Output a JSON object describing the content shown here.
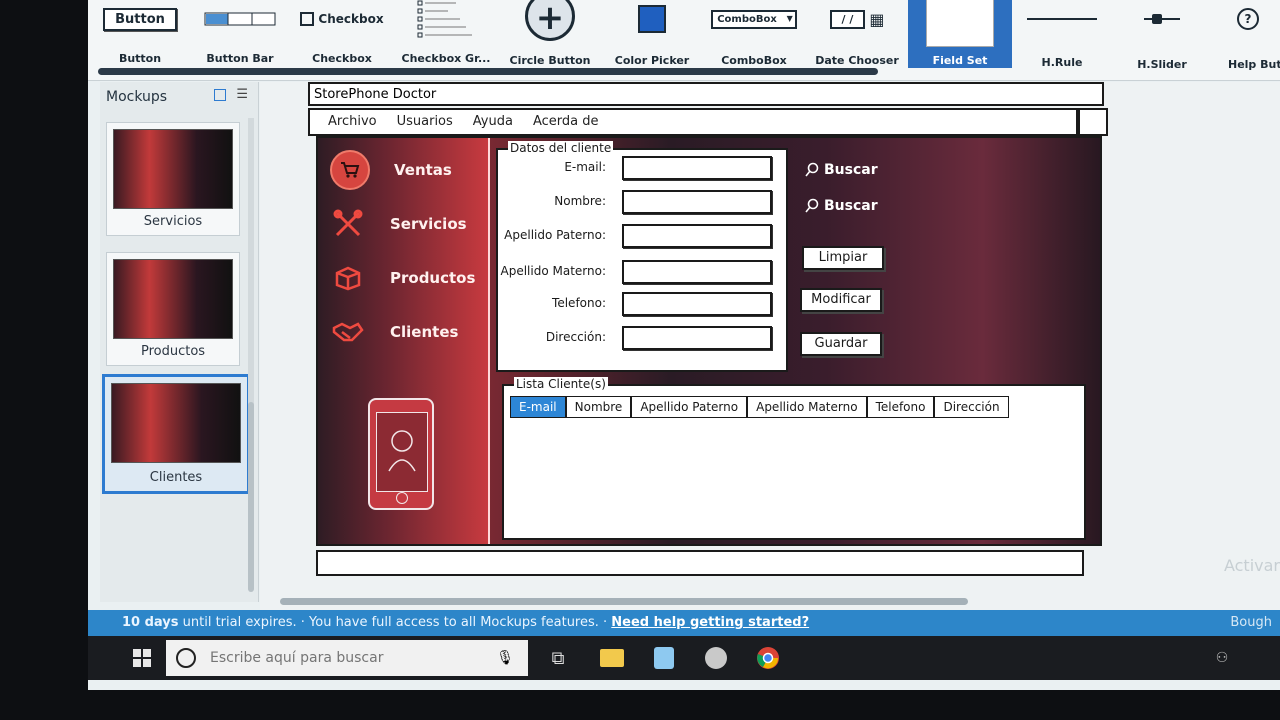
{
  "library": {
    "items": [
      {
        "label": "Button",
        "icon_text": "Button"
      },
      {
        "label": "Button Bar",
        "icon_text": ""
      },
      {
        "label": "Checkbox",
        "icon_text": "Checkbox"
      },
      {
        "label": "Checkbox Gr...",
        "icon_text": ""
      },
      {
        "label": "Circle Button",
        "icon_text": "+"
      },
      {
        "label": "Color Picker",
        "icon_text": ""
      },
      {
        "label": "ComboBox",
        "icon_text": "ComboBox"
      },
      {
        "label": "Date Chooser",
        "icon_text": "/ /"
      },
      {
        "label": "Field Set",
        "icon_text": ""
      },
      {
        "label": "H.Rule",
        "icon_text": ""
      },
      {
        "label": "H.Slider",
        "icon_text": ""
      },
      {
        "label": "Help Butto",
        "icon_text": "?"
      }
    ]
  },
  "left_panel": {
    "title": "Mockups",
    "mockups": [
      {
        "label": "Servicios"
      },
      {
        "label": "Productos"
      },
      {
        "label": "Clientes"
      }
    ]
  },
  "wireframe": {
    "title": "StorePhone Doctor",
    "menu": [
      "Archivo",
      "Usuarios",
      "Ayuda",
      "Acerda de"
    ],
    "nav": [
      {
        "label": "Ventas",
        "icon": "cart-icon"
      },
      {
        "label": "Servicios",
        "icon": "tools-icon"
      },
      {
        "label": "Productos",
        "icon": "box-icon"
      },
      {
        "label": "Clientes",
        "icon": "handshake-icon"
      }
    ],
    "fieldset_title": "Datos del cliente",
    "fields": [
      {
        "label": "E-mail:",
        "value": ""
      },
      {
        "label": "Nombre:",
        "value": ""
      },
      {
        "label": "Apellido Paterno:",
        "value": ""
      },
      {
        "label": "Apellido Materno:",
        "value": ""
      },
      {
        "label": "Telefono:",
        "value": ""
      },
      {
        "label": "Dirección:",
        "value": ""
      }
    ],
    "search_label_1": "Buscar",
    "search_label_2": "Buscar",
    "buttons": {
      "clear": "Limpiar",
      "modify": "Modificar",
      "save": "Guardar"
    },
    "list_title": "Lista Cliente(s)",
    "columns": [
      "E-mail",
      "Nombre",
      "Apellido Paterno",
      "Apellido Materno",
      "Telefono",
      "Dirección"
    ]
  },
  "trial_bar": {
    "days": "10 days",
    "text": " until trial expires.  ·  You have full access to all Mockups features.  · ",
    "link": "Need help getting started?",
    "right": "Bough"
  },
  "taskbar": {
    "search_placeholder": "Escribe aquí para buscar"
  },
  "watermark": "Activar"
}
